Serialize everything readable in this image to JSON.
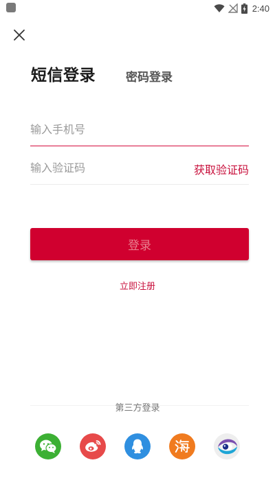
{
  "status_bar": {
    "time": "2:40",
    "icons": [
      "app-indicator-icon",
      "wifi-icon",
      "no-signal-icon",
      "battery-charging-icon"
    ]
  },
  "header": {
    "close_icon": "close-icon"
  },
  "tabs": {
    "sms_login": "短信登录",
    "password_login": "密码登录",
    "active": "sms_login"
  },
  "form": {
    "phone_placeholder": "输入手机号",
    "phone_value": "",
    "code_placeholder": "输入验证码",
    "code_value": "",
    "get_code_label": "获取验证码"
  },
  "actions": {
    "login_label": "登录",
    "register_label": "立即注册"
  },
  "third_party": {
    "title": "第三方登录",
    "providers": [
      {
        "id": "wechat",
        "icon": "wechat-icon",
        "color": "#3cb034"
      },
      {
        "id": "weibo",
        "icon": "weibo-icon",
        "color": "#e74a4a"
      },
      {
        "id": "qq",
        "icon": "qq-icon",
        "color": "#2f8fe0"
      },
      {
        "id": "hai",
        "icon": "hai-icon",
        "color": "#f07b1f"
      },
      {
        "id": "eye",
        "icon": "eye-logo-icon",
        "color": "#1b2f8a"
      }
    ]
  },
  "colors": {
    "accent": "#d0002f",
    "link": "#c8103c",
    "input_underline_active": "#d40a3c"
  }
}
